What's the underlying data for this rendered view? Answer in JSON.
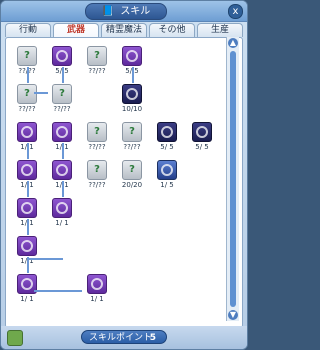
{
  "title": "スキル",
  "close_label": "x",
  "tabs": [
    "行動",
    "武器",
    "精霊魔法",
    "その他",
    "生産"
  ],
  "active_tab": 1,
  "skills": [
    {
      "row": 0,
      "col": 0,
      "label": "??/??",
      "kind": "gray",
      "icon": "question-icon"
    },
    {
      "row": 0,
      "col": 1,
      "label": "5/ 5",
      "kind": "purple",
      "icon": "skill-icon"
    },
    {
      "row": 0,
      "col": 2,
      "label": "??/??",
      "kind": "gray",
      "icon": "question-icon"
    },
    {
      "row": 0,
      "col": 3,
      "label": "5/ 5",
      "kind": "purple",
      "icon": "skill-icon"
    },
    {
      "row": 1,
      "col": 0,
      "label": "??/??",
      "kind": "gray",
      "icon": "question-icon"
    },
    {
      "row": 1,
      "col": 1,
      "label": "??/??",
      "kind": "gray",
      "icon": "question-icon"
    },
    {
      "row": 1,
      "col": 3,
      "label": "10/10",
      "kind": "dark",
      "icon": "tree-icon"
    },
    {
      "row": 2,
      "col": 0,
      "label": "1/ 1",
      "kind": "purple",
      "icon": "skill-icon"
    },
    {
      "row": 2,
      "col": 1,
      "label": "1/ 1",
      "kind": "purple",
      "icon": "skill-icon"
    },
    {
      "row": 2,
      "col": 2,
      "label": "??/??",
      "kind": "gray",
      "icon": "question-icon"
    },
    {
      "row": 2,
      "col": 3,
      "label": "??/??",
      "kind": "gray",
      "icon": "question-icon"
    },
    {
      "row": 2,
      "col": 4,
      "label": "5/ 5",
      "kind": "dark",
      "icon": "creature-icon"
    },
    {
      "row": 2,
      "col": 5,
      "label": "5/ 5",
      "kind": "dark",
      "icon": "creature-icon"
    },
    {
      "row": 3,
      "col": 0,
      "label": "1/ 1",
      "kind": "purple",
      "icon": "skill-icon"
    },
    {
      "row": 3,
      "col": 1,
      "label": "1/ 1",
      "kind": "purple",
      "icon": "skill-icon"
    },
    {
      "row": 3,
      "col": 2,
      "label": "??/??",
      "kind": "gray",
      "icon": "question-icon"
    },
    {
      "row": 3,
      "col": 3,
      "label": "20/20",
      "kind": "gray",
      "icon": "skill-icon"
    },
    {
      "row": 3,
      "col": 4,
      "label": "1/ 5",
      "kind": "blue",
      "icon": "skill-icon"
    },
    {
      "row": 4,
      "col": 0,
      "label": "1/ 1",
      "kind": "purple",
      "icon": "skill-icon"
    },
    {
      "row": 4,
      "col": 1,
      "label": "1/ 1",
      "kind": "purple",
      "icon": "skill-icon"
    },
    {
      "row": 5,
      "col": 0,
      "label": "1/ 1",
      "kind": "purple",
      "icon": "skill-icon"
    },
    {
      "row": 6,
      "col": 0,
      "label": "1/ 1",
      "kind": "purple",
      "icon": "skill-icon"
    },
    {
      "row": 6,
      "col": 2,
      "label": "1/ 1",
      "kind": "purple",
      "icon": "skill-icon"
    }
  ],
  "bottom": {
    "points_label": "スキルポイント",
    "points_value": "5"
  }
}
